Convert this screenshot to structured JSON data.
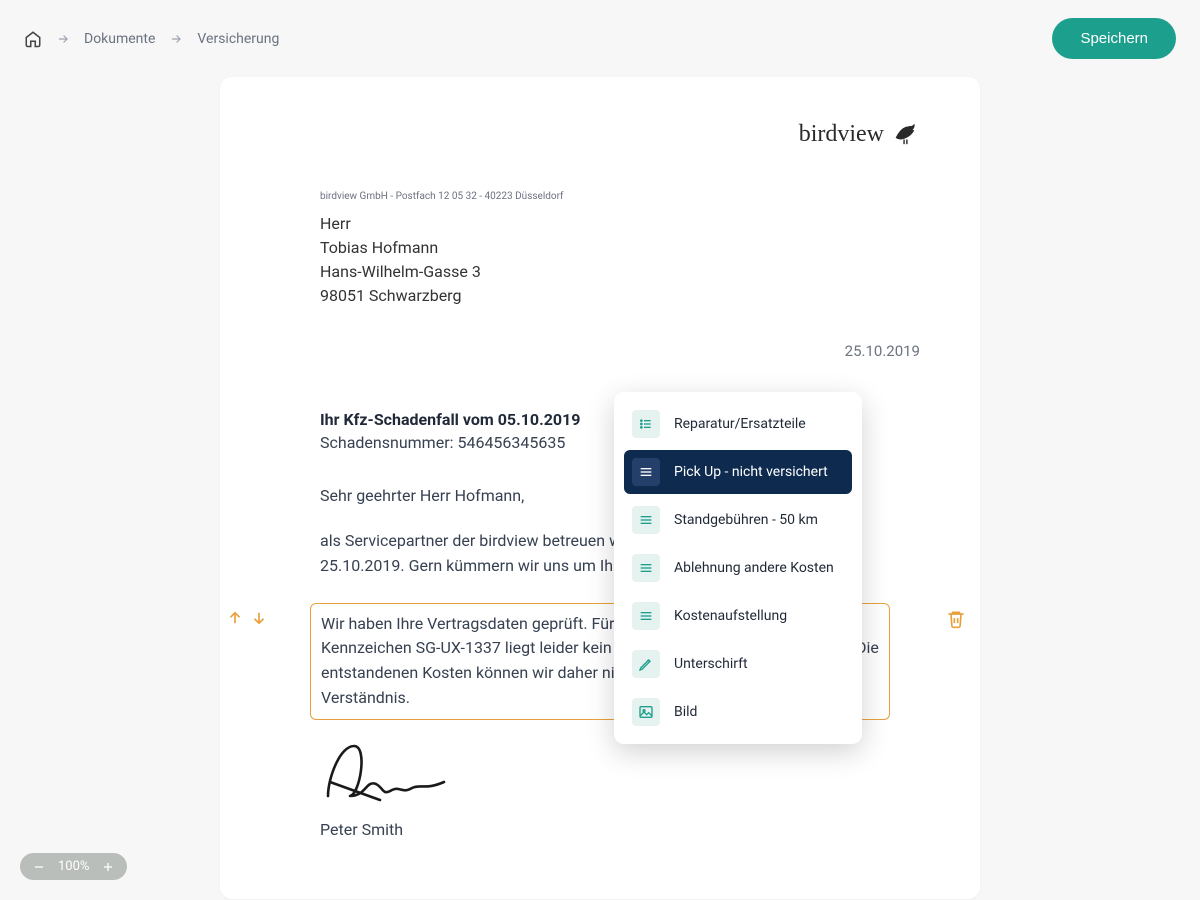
{
  "breadcrumbs": {
    "items": [
      "Dokumente",
      "Versicherung"
    ]
  },
  "actions": {
    "save_label": "Speichern"
  },
  "document": {
    "logo_text": "birdview",
    "sender_line": "birdview GmbH - Postfach 12 05 32 - 40223 Düsseldorf",
    "recipient": {
      "salutation": "Herr",
      "name": "Tobias Hofmann",
      "street": "Hans-Wilhelm-Gasse 3",
      "city": "98051 Schwarzberg"
    },
    "date": "25.10.2019",
    "subject": "Ihr Kfz-Schadenfall vom 05.10.2019",
    "claim_number_line": "Schadensnummer: 546456345635",
    "salutation_line": "Sehr geehrter Herr Hofmann,",
    "body_paragraph_1": "als Servicepartner der birdview betreuen wir Ihre Schadensmeldung vom 25.10.2019. Gern kümmern wir uns um Ihr Anliegen.",
    "highlighted_paragraph": "Wir haben Ihre Vertragsdaten geprüft. Für Ihr Fahrzeug mit dem amtlichen Kennzeichen SG-UX-1337 liegt leider kein gültiger Versicherungsschutz vor. Die entstandenen Kosten können wir daher nicht übernehmen. Wir bitten um Ihr Verständnis.",
    "signer_name": "Peter Smith"
  },
  "context_menu": {
    "items": [
      {
        "icon": "list",
        "label": "Reparatur/Ersatzteile",
        "active": false
      },
      {
        "icon": "lines",
        "label": "Pick Up - nicht versichert",
        "active": true
      },
      {
        "icon": "lines",
        "label": "Standgebühren - 50 km",
        "active": false
      },
      {
        "icon": "lines",
        "label": "Ablehnung andere Kosten",
        "active": false
      },
      {
        "icon": "lines",
        "label": "Kostenaufstellung",
        "active": false
      },
      {
        "icon": "pen",
        "label": "Unterschirft",
        "active": false
      },
      {
        "icon": "image",
        "label": "Bild",
        "active": false
      }
    ]
  },
  "zoom": {
    "level": "100%"
  }
}
